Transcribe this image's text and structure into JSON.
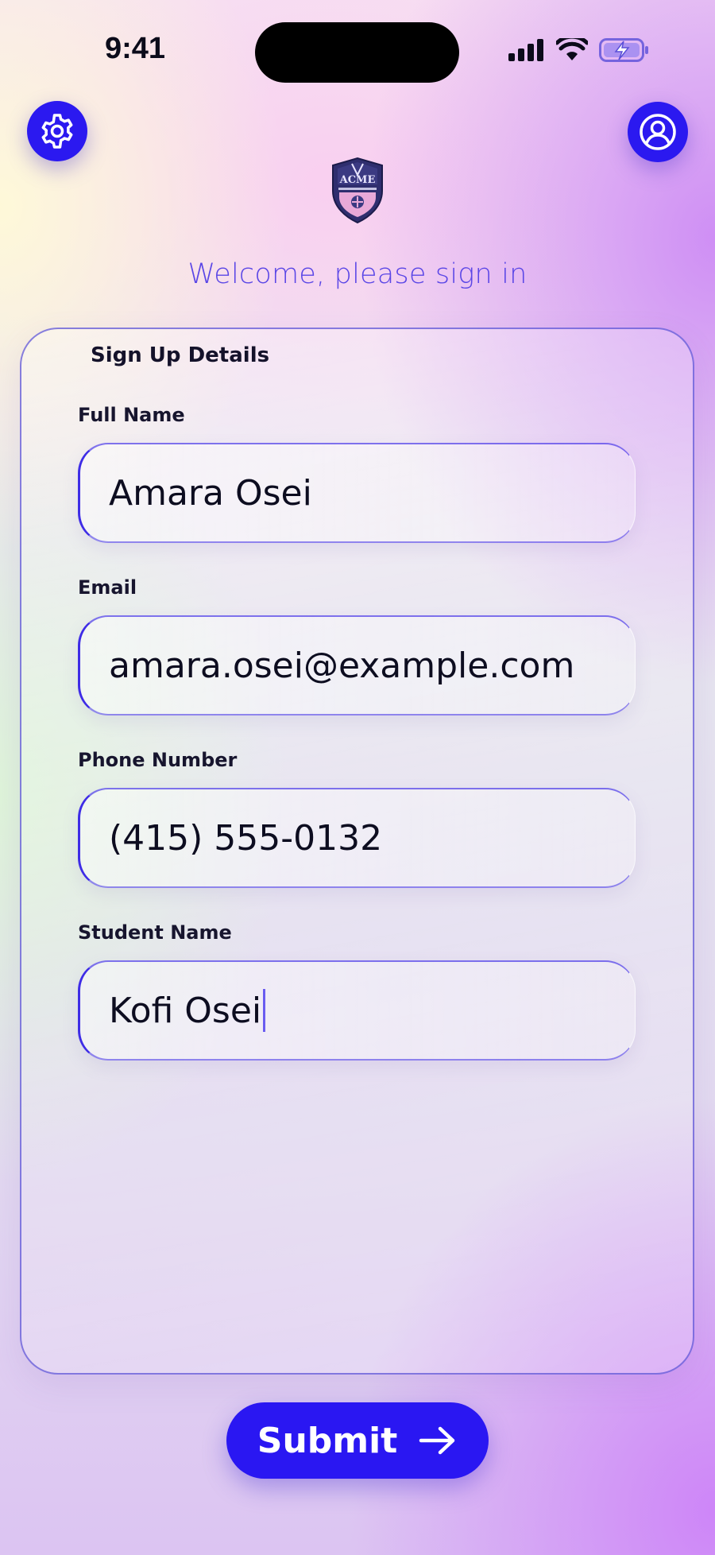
{
  "status_bar": {
    "time": "9:41"
  },
  "header": {
    "welcome": "Welcome, please sign in"
  },
  "form": {
    "title": "Sign Up Details",
    "fields": [
      {
        "label": "Full Name",
        "value": "Amara Osei"
      },
      {
        "label": "Email",
        "value": "amara.osei@example.com"
      },
      {
        "label": "Phone Number",
        "value": "(415) 555-0132"
      },
      {
        "label": "Student Name",
        "value": "Kofi Osei"
      }
    ]
  },
  "submit": {
    "label": "Submit"
  },
  "icons": {
    "settings": "gear-icon",
    "profile": "user-circle-icon",
    "submit": "arrow-right-icon",
    "signal": "cellular-signal-icon",
    "wifi": "wifi-icon",
    "battery": "battery-charging-icon"
  },
  "logo": {
    "text": "ACME"
  },
  "colors": {
    "accent": "#2b19f0",
    "welcome_text": "#5a46e6",
    "card_border": "#5f55d7",
    "text": "#0d0d20"
  }
}
